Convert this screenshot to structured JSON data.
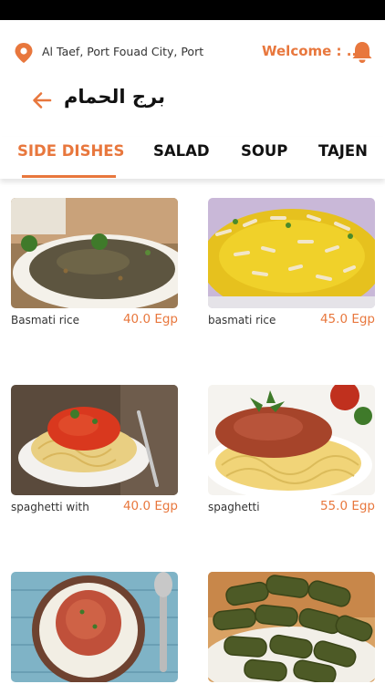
{
  "header": {
    "location": "Al Taef, Port Fouad City, Port",
    "welcome": "Welcome : ...",
    "location_icon": "map-pin-icon",
    "notification_icon": "bell-icon"
  },
  "page": {
    "title": "برج الحمام",
    "back_icon": "back-arrow-icon"
  },
  "tabs": [
    {
      "label": "SIDE DISHES",
      "active": true
    },
    {
      "label": "SALAD",
      "active": false
    },
    {
      "label": "SOUP",
      "active": false
    },
    {
      "label": "TAJEN",
      "active": false
    }
  ],
  "products": [
    {
      "name": "Basmati rice",
      "price": "40.0 Egp"
    },
    {
      "name": "basmati rice",
      "price": "45.0 Egp"
    },
    {
      "name": "spaghetti with",
      "price": "40.0 Egp"
    },
    {
      "name": "spaghetti",
      "price": "55.0 Egp"
    },
    {
      "name": "",
      "price": ""
    },
    {
      "name": "",
      "price": ""
    }
  ],
  "colors": {
    "accent": "#e8773d",
    "status_bar": "#000000"
  }
}
